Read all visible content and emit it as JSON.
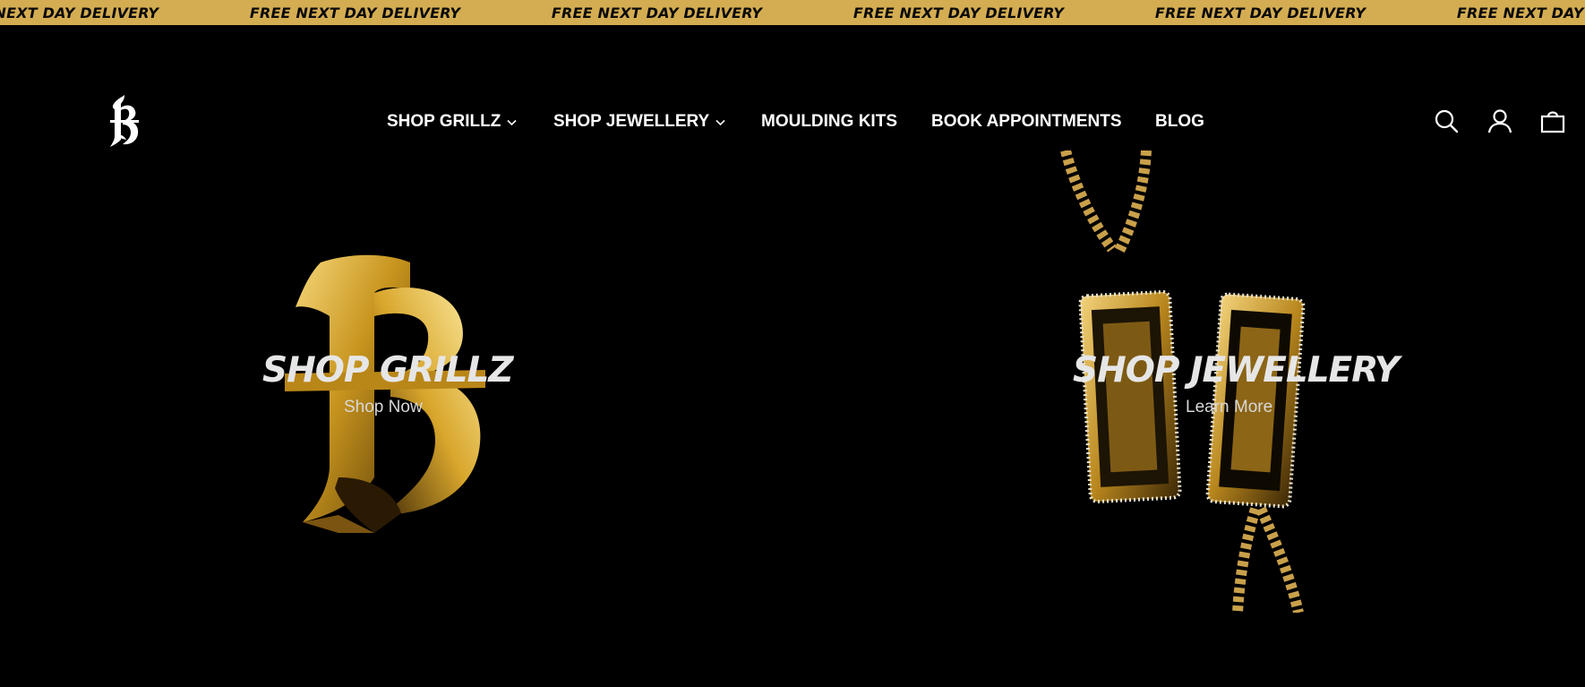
{
  "announcement": {
    "text": "FREE NEXT DAY DELIVERY",
    "repeats": [
      "FREE NEXT DAY DELIVERY",
      "FREE NEXT DAY DELIVERY",
      "FREE NEXT DAY DELIVERY",
      "FREE NEXT DAY DELIVERY",
      "FREE NEXT DAY DELIVERY",
      "FREE NEXT DAY DELIVERY"
    ],
    "background": "#d4ad52",
    "color": "#0a0a0a"
  },
  "header": {
    "logo_icon": "gothic-monogram-logo",
    "nav": [
      {
        "label": "SHOP GRILLZ",
        "dropdown": true
      },
      {
        "label": "SHOP JEWELLERY",
        "dropdown": true
      },
      {
        "label": "MOULDING KITS",
        "dropdown": false
      },
      {
        "label": "BOOK APPOINTMENTS",
        "dropdown": false
      },
      {
        "label": "BLOG",
        "dropdown": false
      }
    ],
    "icons": [
      "search-icon",
      "account-icon",
      "cart-icon"
    ]
  },
  "hero": {
    "panels": [
      {
        "title": "SHOP GRILLZ",
        "link": "Shop Now",
        "image": "gold-monogram-grillz"
      },
      {
        "title": "SHOP JEWELLERY",
        "link": "Learn More",
        "image": "gold-pendant-chains"
      }
    ]
  },
  "colors": {
    "background": "#000000",
    "accent_gold": "#d4ad52",
    "text": "#ffffff"
  }
}
